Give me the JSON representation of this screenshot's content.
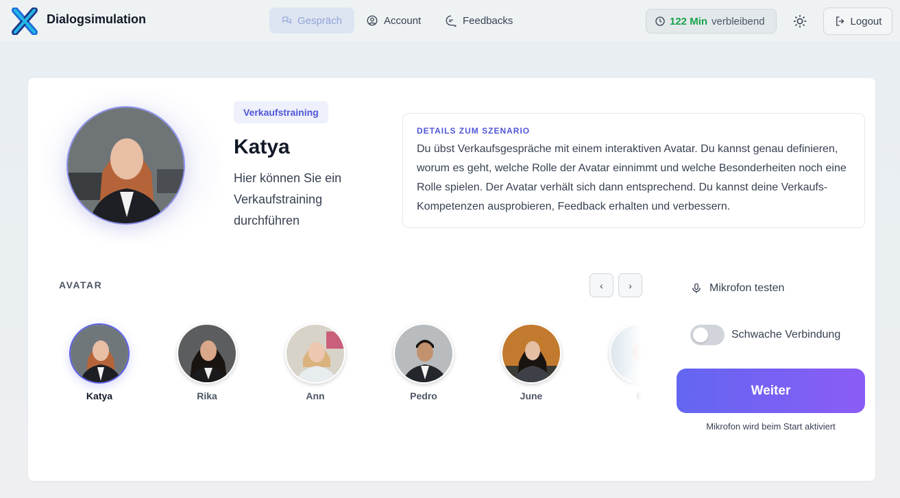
{
  "header": {
    "brand": "Dialogsimulation",
    "nav": [
      {
        "label": "Gespräch",
        "icon": "chat-icon",
        "active": true
      },
      {
        "label": "Account",
        "icon": "user-circle-icon",
        "active": false
      },
      {
        "label": "Feedbacks",
        "icon": "feedback-icon",
        "active": false
      }
    ],
    "time_remaining": {
      "value": "122 Min",
      "suffix": "verbleibend"
    },
    "logout_label": "Logout"
  },
  "scenario": {
    "tag": "Verkaufstraining",
    "name": "Katya",
    "description": "Hier können Sie ein Verkaufstraining durchführen",
    "details_title": "DETAILS ZUM SZENARIO",
    "details_text": "Du übst Verkaufsgespräche mit einem interaktiven Avatar. Du kannst genau definieren, worum es geht, welche Rolle der Avatar einnimmt und welche Besonderheiten noch eine Rolle spielen. Der Avatar verhält sich dann entsprechend. Du kannst deine Verkaufs-Kompetenzen ausprobieren, Feedback erhalten und verbessern."
  },
  "avatars": {
    "label": "AVATAR",
    "items": [
      {
        "name": "Katya",
        "selected": true
      },
      {
        "name": "Rika",
        "selected": false
      },
      {
        "name": "Ann",
        "selected": false
      },
      {
        "name": "Pedro",
        "selected": false
      },
      {
        "name": "June",
        "selected": false
      },
      {
        "name": "E",
        "selected": false
      }
    ]
  },
  "controls": {
    "mic_test_label": "Mikrofon testen",
    "weak_connection_label": "Schwache Verbindung",
    "weak_connection_on": false,
    "continue_label": "Weiter",
    "continue_note": "Mikrofon wird beim Start aktiviert"
  },
  "colors": {
    "accent": "#5b5fe6",
    "button_gradient_start": "#6366f1",
    "button_gradient_end": "#8b5cf6",
    "time_green": "#16a34a"
  }
}
